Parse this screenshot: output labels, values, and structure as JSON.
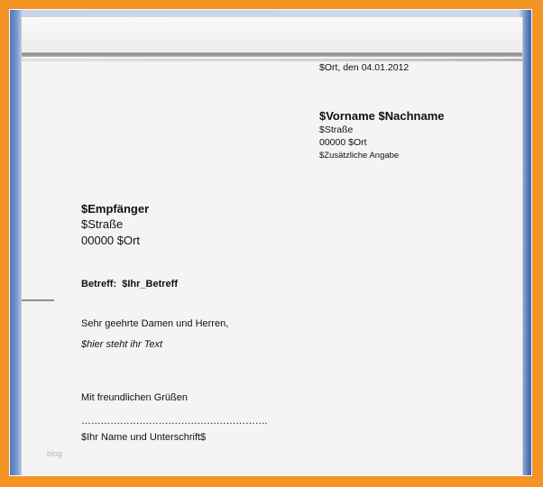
{
  "sender": {
    "place_date": "$Ort, den 04.01.2012",
    "name": "$Vorname $Nachname",
    "street": "$Straße",
    "city": "00000 $Ort",
    "extra": "$Zusätzliche Angabe"
  },
  "recipient": {
    "name": "$Empfänger",
    "street": "$Straße",
    "city": "00000 $Ort"
  },
  "subject": {
    "label": "Betreff:",
    "value": "$Ihr_Betreff"
  },
  "letter": {
    "salutation": "Sehr geehrte Damen und Herren,",
    "body": "$hier steht ihr Text",
    "closing": "Mit freundlichen Grüßen",
    "signature_line": "………………………………………………….",
    "signature_name": "$Ihr Name und Unterschrift$"
  },
  "watermark": "blog",
  "colors": {
    "frame": "#f39424",
    "viewer_edge": "#4e76b8",
    "page": "#f4f4f4"
  }
}
